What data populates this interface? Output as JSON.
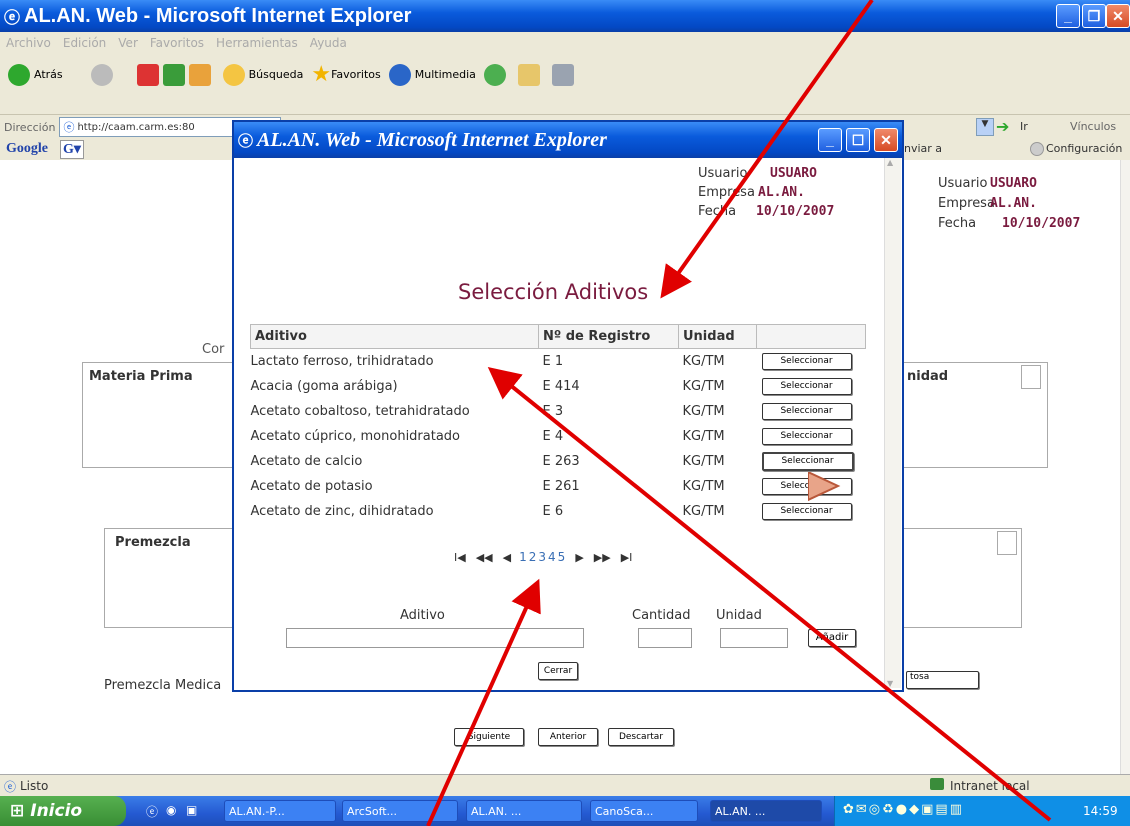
{
  "main_window": {
    "title": "AL.AN. Web - Microsoft Internet Explorer",
    "menu": [
      "Archivo",
      "Edición",
      "Ver",
      "Favoritos",
      "Herramientas",
      "Ayuda"
    ],
    "toolbar": {
      "back": "Atrás",
      "search": "Búsqueda",
      "favorites": "Favoritos",
      "multimedia": "Multimedia"
    },
    "address_label": "Dirección",
    "address_value": "http://caam.carm.es:80",
    "go_label": "Ir",
    "links_label": "Vínculos",
    "google_label": "Google",
    "send_label": "nviar a",
    "config_label": "Configuración",
    "user_info": {
      "usuario_label": "Usuario",
      "usuario": "USUARO",
      "empresa_label": "Empresa",
      "empresa": "AL.AN.",
      "fecha_label": "Fecha",
      "fecha": "10/10/2007"
    },
    "partial_left_text": "Cor",
    "materia_header": "Materia Prima",
    "unidad_partial": "nidad",
    "premezcla_header": "Premezcla",
    "premezcla_medica": "Premezcla Medica",
    "tosa_label": "tosa",
    "bottom_buttons": {
      "siguiente": "Siguiente",
      "anterior": "Anterior",
      "descartar": "Descartar"
    },
    "status": {
      "listo": "Listo",
      "zone": "Intranet local"
    }
  },
  "popup": {
    "title": "AL.AN. Web - Microsoft Internet Explorer",
    "user_info": {
      "usuario_label": "Usuario",
      "usuario": "USUARO",
      "empresa_label": "Empresa",
      "empresa": "AL.AN.",
      "fecha_label": "Fecha",
      "fecha": "10/10/2007"
    },
    "heading": "Selección Aditivos",
    "columns": [
      "Aditivo",
      "Nº de Registro",
      "Unidad"
    ],
    "rows": [
      {
        "aditivo": "Lactato ferroso, trihidratado",
        "registro": "E 1",
        "unidad": "KG/TM"
      },
      {
        "aditivo": "Acacia (goma arábiga)",
        "registro": "E 414",
        "unidad": "KG/TM"
      },
      {
        "aditivo": "Acetato cobaltoso, tetrahidratado",
        "registro": "E 3",
        "unidad": "KG/TM"
      },
      {
        "aditivo": "Acetato cúprico, monohidratado",
        "registro": "E 4",
        "unidad": "KG/TM"
      },
      {
        "aditivo": "Acetato de calcio",
        "registro": "E 263",
        "unidad": "KG/TM"
      },
      {
        "aditivo": "Acetato de potasio",
        "registro": "E 261",
        "unidad": "KG/TM"
      },
      {
        "aditivo": "Acetato de zinc, dihidratado",
        "registro": "E 6",
        "unidad": "KG/TM"
      }
    ],
    "select_label": "Seleccionar",
    "pager": {
      "first": "I◀",
      "prev_page": "◀◀",
      "prev": "◀",
      "pages": [
        "1",
        "2",
        "3",
        "4",
        "5"
      ],
      "next": "▶",
      "next_page": "▶▶",
      "last": "▶I"
    },
    "form": {
      "aditivo_label": "Aditivo",
      "cantidad_label": "Cantidad",
      "unidad_label": "Unidad",
      "add_label": "Añadir"
    },
    "close_label": "Cerrar"
  },
  "taskbar": {
    "start": "Inicio",
    "items": [
      "AL.AN.-P...",
      "ArcSoft...",
      "AL.AN. ...",
      "CanoSca...",
      "AL.AN. ..."
    ],
    "clock": "14:59"
  },
  "colors": {
    "accent": "#7a1b3f",
    "arrow": "#e00000",
    "xp_blue": "#0a5bdc"
  }
}
